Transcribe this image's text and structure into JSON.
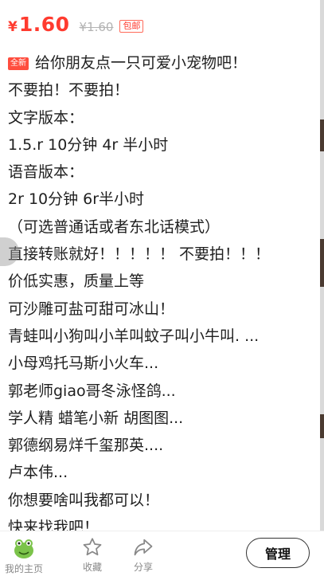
{
  "price": {
    "currency": "¥",
    "current": "1.60",
    "original": "¥1.60",
    "shipping_badge": "包邮"
  },
  "description": {
    "new_tag": "全新",
    "lines": [
      "给你朋友点一只可爱小宠物吧！",
      "不要拍！不要拍！",
      "文字版本：",
      "1.5.r 10分钟 4r 半小时",
      "语音版本：",
      "2r 10分钟   6r半小时",
      "（可选普通话或者东北话模式）",
      "直接转账就好！！！！！ 不要拍！！！",
      "价低实惠，质量上等",
      "可沙雕可盐可甜可冰山！",
      "青蛙叫小狗叫小羊叫蚊子叫小牛叫. ...",
      "小母鸡托马斯小火车...",
      "郭老师giao哥冬泳怪鸽...",
      "学人精 蜡笔小新 胡图图...",
      "郭德纲易烊千玺那英....",
      "卢本伟...",
      "你想要啥叫我都可以！",
      "快来找我吧！"
    ]
  },
  "bottom_bar": {
    "home_label": "我的主页",
    "favorite_label": "收藏",
    "share_label": "分享",
    "manage_label": "管理",
    "icons": [
      "frog-avatar-icon",
      "star-icon",
      "share-arrow-icon"
    ]
  },
  "colors": {
    "price": "#ff3b2f",
    "tag": "#ff4d3e",
    "muted": "#888888"
  }
}
